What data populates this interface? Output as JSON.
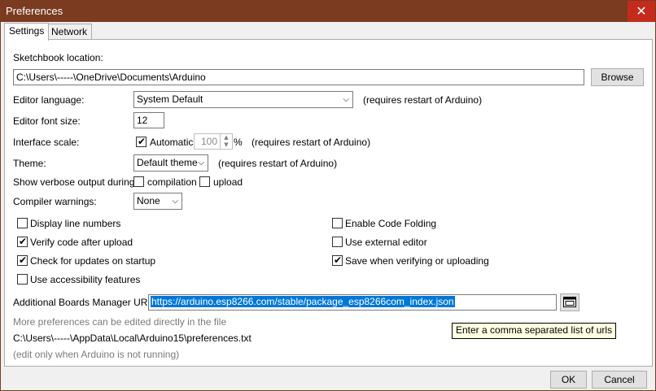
{
  "window": {
    "title": "Preferences",
    "close_glyph": "✕"
  },
  "tabs": [
    {
      "label": "Settings"
    },
    {
      "label": "Network"
    }
  ],
  "sketchbook": {
    "label": "Sketchbook location:",
    "path": "C:\\Users\\-----\\OneDrive\\Documents\\Arduino",
    "browse_label": "Browse"
  },
  "editor_language": {
    "label": "Editor language:",
    "value": "System Default",
    "note": "(requires restart of Arduino)"
  },
  "font_size": {
    "label": "Editor font size:",
    "value": "12"
  },
  "interface_scale": {
    "label": "Interface scale:",
    "automatic_label": "Automatic",
    "automatic_checked": true,
    "value": "100",
    "unit": "%",
    "note": "(requires restart of Arduino)"
  },
  "theme": {
    "label": "Theme:",
    "value": "Default theme",
    "note": "(requires restart of Arduino)"
  },
  "verbose": {
    "label": "Show verbose output during:",
    "compilation_label": "compilation",
    "compilation_checked": false,
    "upload_label": "upload",
    "upload_checked": false
  },
  "compiler_warnings": {
    "label": "Compiler warnings:",
    "value": "None"
  },
  "options_left": [
    {
      "label": "Display line numbers",
      "checked": false
    },
    {
      "label": "Verify code after upload",
      "checked": true
    },
    {
      "label": "Check for updates on startup",
      "checked": true
    },
    {
      "label": "Use accessibility features",
      "checked": false
    }
  ],
  "options_right": [
    {
      "label": "Enable Code Folding",
      "checked": false
    },
    {
      "label": "Use external editor",
      "checked": false
    },
    {
      "label": "Save when verifying or uploading",
      "checked": true
    }
  ],
  "boards_manager": {
    "label": "Additional Boards Manager URLs:",
    "value": "https://arduino.esp8266.com/stable/package_esp8266com_index.json",
    "tooltip": "Enter a comma separated list of urls"
  },
  "more_prefs": {
    "hint": "More preferences can be edited directly in the file",
    "path": "C:\\Users\\-----\\AppData\\Local\\Arduino15\\preferences.txt",
    "note": "(edit only when Arduino is not running)"
  },
  "footer": {
    "ok_label": "OK",
    "cancel_label": "Cancel"
  },
  "colors": {
    "titlebar": "#7a3b21",
    "close": "#c42b1c",
    "selection": "#0078d7",
    "tooltip_bg": "#ffffe1"
  },
  "icons": {
    "dropdown": "chevron-down-icon",
    "url_editor": "window-icon",
    "check": "checkmark-icon"
  }
}
